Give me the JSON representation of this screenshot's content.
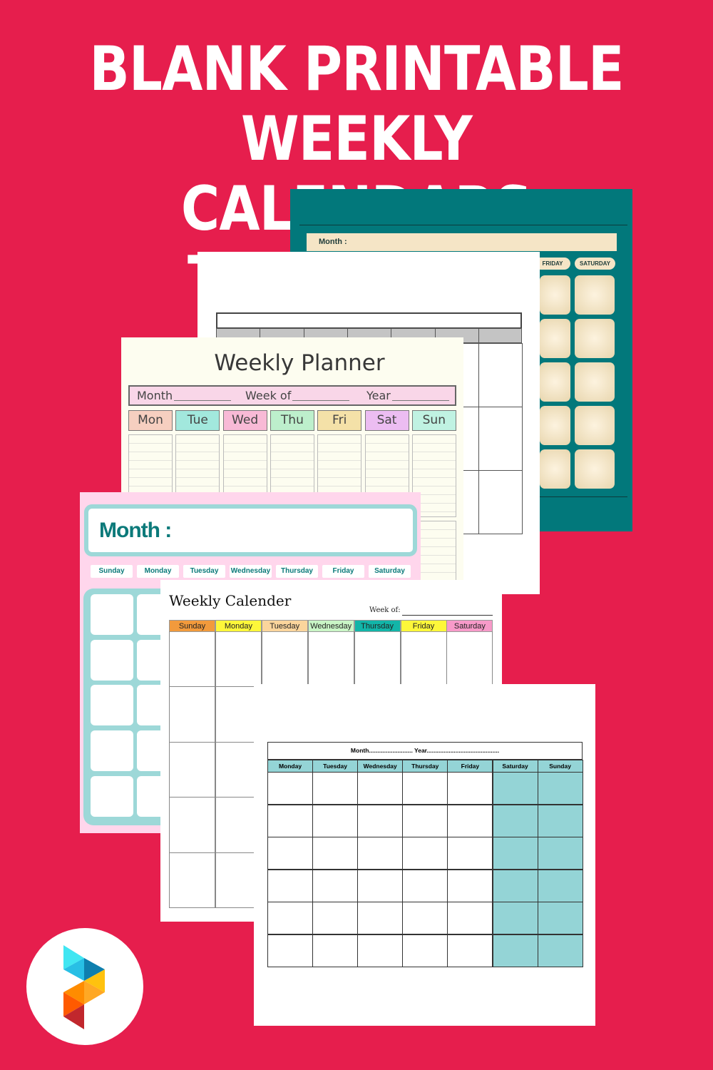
{
  "title": {
    "line1": "BLANK PRINTABLE WEEKLY",
    "line2": "CALENDARS TEMPLATES"
  },
  "colors": {
    "background": "#e61e4d",
    "teal": "#02787b",
    "cream": "#f5e5c6",
    "aqua": "#94d4d6",
    "pink": "#ffd6ec"
  },
  "teal_template": {
    "month_label": "Month :",
    "days": [
      "FRIDAY",
      "SATURDAY"
    ]
  },
  "planner": {
    "title": "Weekly Planner",
    "month_label": "Month",
    "week_label": "Week of",
    "year_label": "Year",
    "days": [
      {
        "label": "Mon",
        "color": "#f6cfc0"
      },
      {
        "label": "Tue",
        "color": "#a2e8dd"
      },
      {
        "label": "Wed",
        "color": "#f8bad6"
      },
      {
        "label": "Thu",
        "color": "#bdefcc"
      },
      {
        "label": "Fri",
        "color": "#f4e1a8"
      },
      {
        "label": "Sat",
        "color": "#ecbdf2"
      },
      {
        "label": "Sun",
        "color": "#c0f2e2"
      }
    ]
  },
  "pink_template": {
    "month_label": "Month :",
    "days": [
      "Sunday",
      "Monday",
      "Tuesday",
      "Wednesday",
      "Thursday",
      "Friday",
      "Saturday"
    ]
  },
  "weekly_calender": {
    "title": "Weekly Calender",
    "week_label": "Week of:",
    "days": [
      {
        "label": "Sunday",
        "color": "#f29a3c"
      },
      {
        "label": "Monday",
        "color": "#fdf73a"
      },
      {
        "label": "Tuesday",
        "color": "#fbd59c"
      },
      {
        "label": "Wednesday",
        "color": "#c9f5c6"
      },
      {
        "label": "Thursday",
        "color": "#12b5a8"
      },
      {
        "label": "Friday",
        "color": "#fdf73a"
      },
      {
        "label": "Saturday",
        "color": "#f79ac9"
      }
    ]
  },
  "bottom_template": {
    "header": "Month.......................... Year...........................................",
    "days": [
      "Monday",
      "Tuesday",
      "Wednesday",
      "Thursday",
      "Friday",
      "Saturday",
      "Sunday"
    ]
  },
  "logo": {
    "name": "printable-logo"
  }
}
